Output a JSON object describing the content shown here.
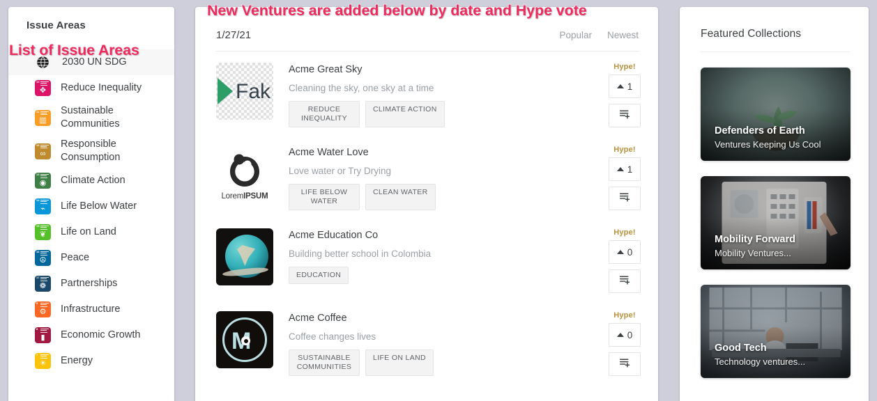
{
  "annotations": {
    "top": "New Ventures are added below by date and Hype vote",
    "sidebar": "List of Issue Areas"
  },
  "sidebar": {
    "title": "Issue Areas",
    "items": [
      {
        "label": "2030 UN SDG",
        "icon": "globe-icon",
        "color": "#000000",
        "number": "",
        "selected": true
      },
      {
        "label": "Reduce Inequality",
        "icon": "sdg-reduce-inequality-icon",
        "color": "#dd1367",
        "number": "10",
        "selected": false
      },
      {
        "label": "Sustainable Communities",
        "icon": "sdg-sustainable-cities-icon",
        "color": "#f99d26",
        "number": "11",
        "selected": false
      },
      {
        "label": "Responsible Consumption",
        "icon": "sdg-responsible-consumption-icon",
        "color": "#bf8b2e",
        "number": "12",
        "selected": false
      },
      {
        "label": "Climate Action",
        "icon": "sdg-climate-action-icon",
        "color": "#3f7e44",
        "number": "13",
        "selected": false
      },
      {
        "label": "Life Below Water",
        "icon": "sdg-life-below-water-icon",
        "color": "#0a97d9",
        "number": "14",
        "selected": false
      },
      {
        "label": "Life on Land",
        "icon": "sdg-life-on-land-icon",
        "color": "#56c02b",
        "number": "15",
        "selected": false
      },
      {
        "label": "Peace",
        "icon": "sdg-peace-justice-icon",
        "color": "#00689d",
        "number": "16",
        "selected": false
      },
      {
        "label": "Partnerships",
        "icon": "sdg-partnerships-icon",
        "color": "#19486a",
        "number": "17",
        "selected": false
      },
      {
        "label": "Infrastructure",
        "icon": "sdg-industry-innovation-icon",
        "color": "#fd6925",
        "number": "9",
        "selected": false
      },
      {
        "label": "Economic Growth",
        "icon": "sdg-decent-work-icon",
        "color": "#a21942",
        "number": "8",
        "selected": false
      },
      {
        "label": "Energy",
        "icon": "sdg-affordable-energy-icon",
        "color": "#fcc30b",
        "number": "7",
        "selected": false
      }
    ]
  },
  "main": {
    "date": "1/27/21",
    "sorts": [
      {
        "label": "Popular"
      },
      {
        "label": "Newest"
      }
    ],
    "ventures": [
      {
        "name": "Acme Great Sky",
        "tagline": "Cleaning the sky, one sky at a time",
        "tags": [
          "REDUCE INEQUALITY",
          "CLIMATE ACTION"
        ],
        "hype_label": "Hype!",
        "hype_count": "1",
        "logo": "fake-play-logo",
        "add_icon": "add-to-collection-icon"
      },
      {
        "name": "Acme Water Love",
        "tagline": "Love water or Try Drying",
        "tags": [
          "LIFE BELOW WATER",
          "CLEAN WATER"
        ],
        "hype_label": "Hype!",
        "hype_count": "1",
        "logo": "lorem-ipsum-logo",
        "logo_text_light": "Lorem",
        "logo_text_bold": "IPSUM",
        "add_icon": "add-to-collection-icon"
      },
      {
        "name": "Acme Education Co",
        "tagline": "Building better school in Colombia",
        "tags": [
          "EDUCATION"
        ],
        "hype_label": "Hype!",
        "hype_count": "0",
        "logo": "globe-photo",
        "add_icon": "add-to-collection-icon"
      },
      {
        "name": "Acme Coffee",
        "tagline": "Coffee changes lives",
        "tags": [
          "SUSTAINABLE COMMUNITIES",
          "LIFE ON LAND"
        ],
        "hype_label": "Hype!",
        "hype_count": "0",
        "logo": "acme-monster-m-logo",
        "add_icon": "add-to-collection-icon"
      }
    ]
  },
  "featured": {
    "title": "Featured Collections",
    "collections": [
      {
        "name": "Defenders of Earth",
        "desc": "Ventures Keeping Us Cool",
        "image": "hands-holding-seedling"
      },
      {
        "name": "Mobility Forward",
        "desc": "Mobility Ventures...",
        "image": "tablet-design-screen"
      },
      {
        "name": "Good Tech",
        "desc": "Technology ventures...",
        "image": "engineer-at-workstation"
      }
    ]
  },
  "colors": {
    "accent_annotation": "#ef2b5e",
    "hype_gold": "#b9913b",
    "page_background": "#cfcfdb"
  }
}
